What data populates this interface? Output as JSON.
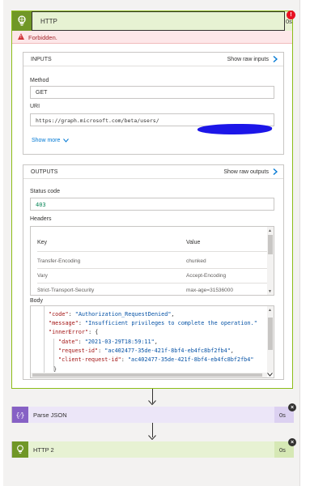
{
  "http_card": {
    "title": "HTTP",
    "duration": "0s",
    "error_badge": "!",
    "error_text": "Forbidden.",
    "colors": {
      "accent": "#709727",
      "header_bg": "#e7f2d3",
      "border": "#8cbd18",
      "error": "#a4262c"
    },
    "inputs": {
      "title": "INPUTS",
      "show_raw_label": "Show raw inputs",
      "method_label": "Method",
      "method_value": "GET",
      "uri_label": "URI",
      "uri_value": "https://graph.microsoft.com/beta/users/",
      "show_more_label": "Show more"
    },
    "outputs": {
      "title": "OUTPUTS",
      "show_raw_label": "Show raw outputs",
      "status_label": "Status code",
      "status_value": "403",
      "headers_label": "Headers",
      "headers_columns": [
        "Key",
        "Value"
      ],
      "headers_rows": [
        {
          "key": "Transfer-Encoding",
          "value": "chunked"
        },
        {
          "key": "Vary",
          "value": "Accept-Encoding"
        },
        {
          "key": "Strict-Transport-Security",
          "value": "max-age=31536000"
        }
      ],
      "body_label": "Body",
      "body_lines": {
        "l1_key": "\"code\"",
        "l1_val": "\"Authorization_RequestDenied\"",
        "l2_key": "\"message\"",
        "l2_val": "\"Insufficient privileges to complete the operation.\"",
        "l3_key": "\"innerError\"",
        "l4_key": "\"date\"",
        "l4_val": "\"2021-03-29T18:59:11\"",
        "l5_key": "\"request-id\"",
        "l5_val": "\"ac402477-35de-421f-8bf4-eb4fc8bf2fb4\"",
        "l6_key": "\"client-request-id\"",
        "l6_val": "\"ac402477-35de-421f-8bf4-eb4fc8bf2fb4\""
      }
    }
  },
  "parse_json_card": {
    "title": "Parse JSON",
    "duration": "0s",
    "colors": {
      "accent": "#8661c5",
      "bg": "#ece6f8"
    }
  },
  "http2_card": {
    "title": "HTTP 2",
    "duration": "0s",
    "colors": {
      "accent": "#709727",
      "bg": "#e7f2d3"
    }
  }
}
